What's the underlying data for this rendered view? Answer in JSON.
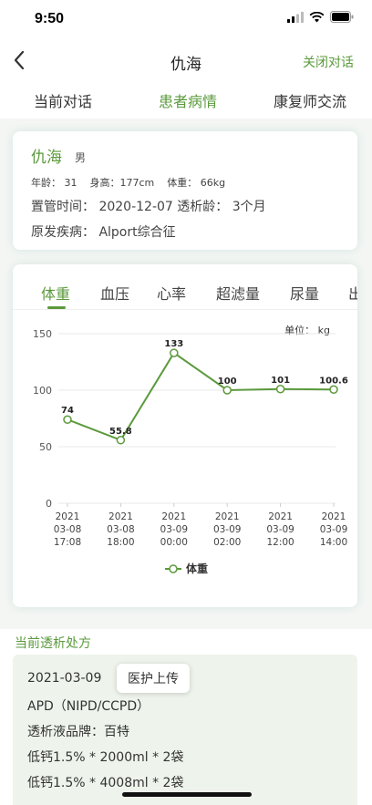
{
  "status_bar": {
    "time": "9:50"
  },
  "nav": {
    "title": "仇海",
    "close_label": "关闭对话"
  },
  "tabs": [
    {
      "label": "当前对话",
      "active": false
    },
    {
      "label": "患者病情",
      "active": true
    },
    {
      "label": "康复师交流",
      "active": false
    }
  ],
  "patient": {
    "name": "仇海",
    "gender": "男",
    "age": "年龄： 31",
    "height": "身高：177cm",
    "weight": "体重： 66kg",
    "catheter": "置管时间： 2020-12-07  透析龄： 3个月",
    "disease": "原发疾病： Alport综合征"
  },
  "chart_tabs": [
    "体重",
    "血压",
    "心率",
    "超滤量",
    "尿量",
    "出"
  ],
  "chart_data": {
    "type": "line",
    "unit_label": "单位： kg",
    "ylim": [
      0,
      150
    ],
    "yticks": [
      0,
      50,
      100,
      150
    ],
    "categories": [
      [
        "2021",
        "03-08",
        "17:08"
      ],
      [
        "2021",
        "03-08",
        "18:00"
      ],
      [
        "2021",
        "03-09",
        "00:00"
      ],
      [
        "2021",
        "03-09",
        "02:00"
      ],
      [
        "2021",
        "03-09",
        "12:00"
      ],
      [
        "2021",
        "03-09",
        "14:00"
      ]
    ],
    "series": [
      {
        "name": "体重",
        "values": [
          74,
          55.8,
          133,
          100,
          101,
          100.6
        ]
      }
    ],
    "legend": "bottom-center",
    "grid": true,
    "color": "#5b9a3c"
  },
  "prescription": {
    "title": "当前透析处方",
    "date": "2021-03-09",
    "upload_label": "医护上传",
    "lines": [
      "APD（NIPD/CCPD）",
      "透析液品牌：百特",
      "低钙1.5% * 2000ml * 2袋",
      "低钙1.5% * 4008ml * 2袋"
    ]
  },
  "colors": {
    "accent": "#5b9a3c"
  }
}
